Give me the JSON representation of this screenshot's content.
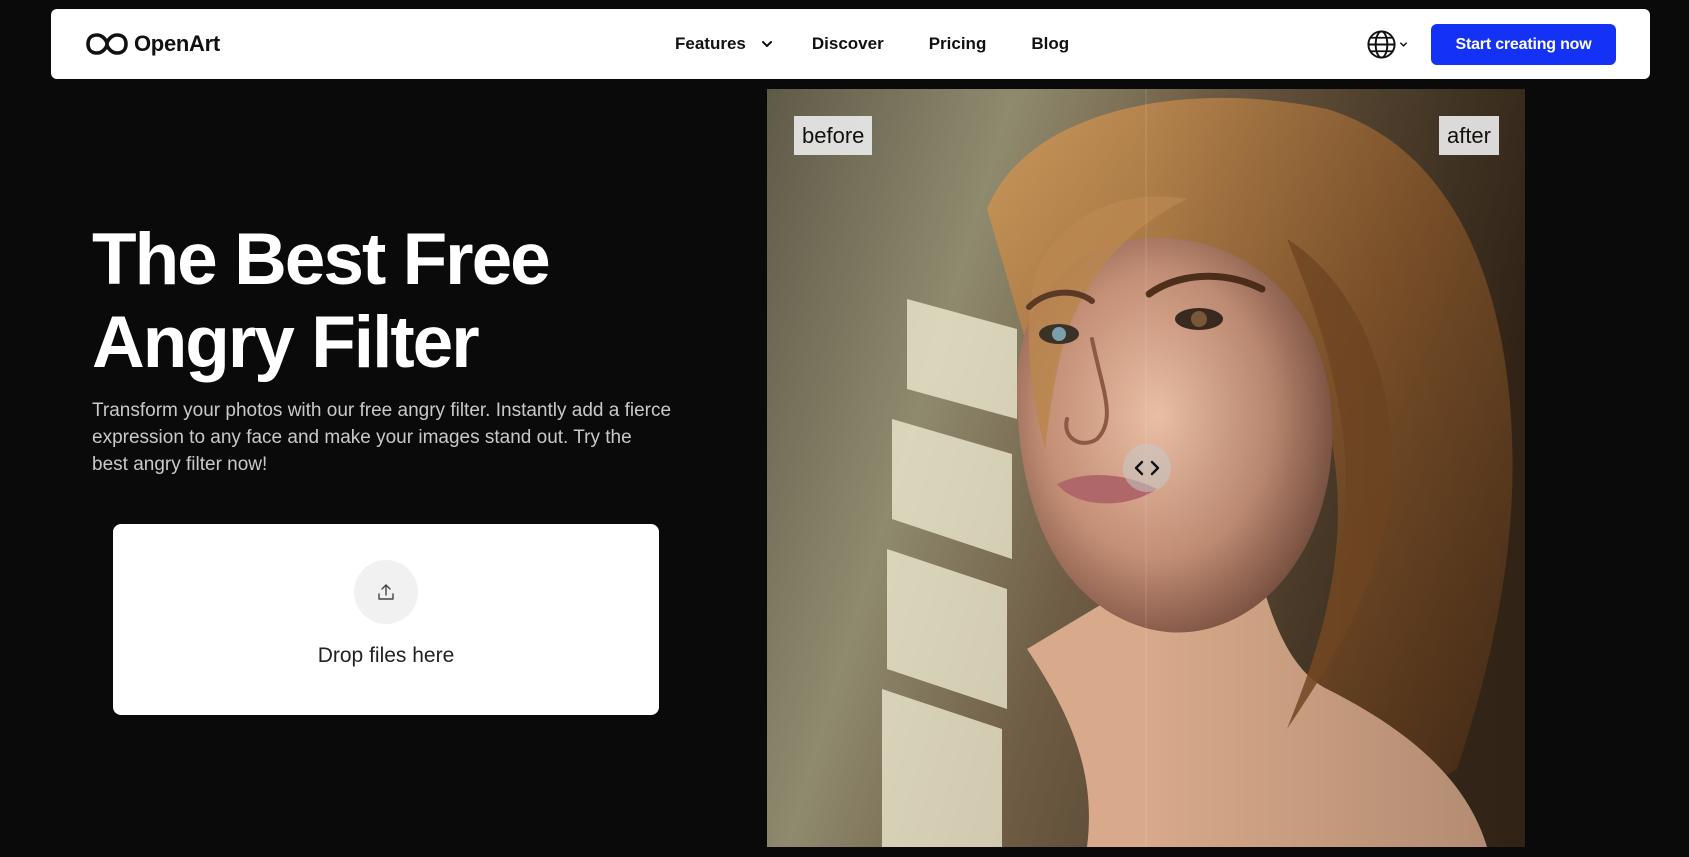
{
  "header": {
    "logo_text": "OpenArt",
    "nav": {
      "features": "Features",
      "discover": "Discover",
      "pricing": "Pricing",
      "blog": "Blog"
    },
    "language_icon": "globe-icon",
    "cta_label": "Start creating now"
  },
  "hero": {
    "title_line1": "The Best Free",
    "title_line2": "Angry Filter",
    "description": "Transform your photos with our free angry filter. Instantly add a fierce expression to any face and make your images stand out. Try the best angry filter now!"
  },
  "upload": {
    "icon": "upload-icon",
    "label": "Drop files here"
  },
  "comparison": {
    "before_label": "before",
    "after_label": "after",
    "handle_icon": "chevrons-left-right-icon"
  },
  "colors": {
    "background": "#0a0a0a",
    "cta": "#1432f5",
    "header": "#ffffff"
  }
}
